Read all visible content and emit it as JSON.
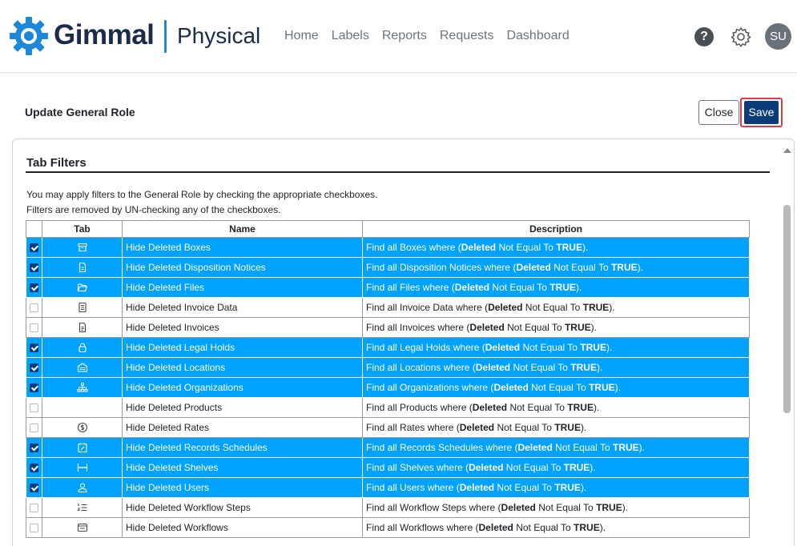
{
  "header": {
    "brand": "Gimmal",
    "product": "Physical",
    "nav": [
      "Home",
      "Labels",
      "Reports",
      "Requests",
      "Dashboard"
    ],
    "help_glyph": "?",
    "avatar_initials": "SU",
    "brand_color": "#1c2b4a",
    "accent_color": "#1e88d8"
  },
  "page": {
    "title": "Update General Role",
    "close_label": "Close",
    "save_label": "Save"
  },
  "tab_filters": {
    "section_title": "Tab Filters",
    "intro_line1": "You may apply filters to the General Role by checking the appropriate checkboxes.",
    "intro_line2": "Filters are removed by UN-checking any of the checkboxes.",
    "columns": [
      "",
      "Tab",
      "Name",
      "Description"
    ],
    "rows": [
      {
        "checked": true,
        "icon": "archive-box-icon",
        "name": "Hide Deleted Boxes",
        "entity": "Boxes"
      },
      {
        "checked": true,
        "icon": "document-icon",
        "name": "Hide Deleted Disposition Notices",
        "entity": "Disposition Notices"
      },
      {
        "checked": true,
        "icon": "folder-open-icon",
        "name": "Hide Deleted Files",
        "entity": "Files"
      },
      {
        "checked": false,
        "icon": "list-document-icon",
        "name": "Hide Deleted Invoice Data",
        "entity": "Invoice Data"
      },
      {
        "checked": false,
        "icon": "invoice-icon",
        "name": "Hide Deleted Invoices",
        "entity": "Invoices"
      },
      {
        "checked": true,
        "icon": "lock-icon",
        "name": "Hide Deleted Legal Holds",
        "entity": "Legal Holds"
      },
      {
        "checked": true,
        "icon": "warehouse-icon",
        "name": "Hide Deleted Locations",
        "entity": "Locations"
      },
      {
        "checked": true,
        "icon": "org-chart-icon",
        "name": "Hide Deleted Organizations",
        "entity": "Organizations"
      },
      {
        "checked": false,
        "icon": "",
        "name": "Hide Deleted Products",
        "entity": "Products"
      },
      {
        "checked": false,
        "icon": "dollar-coin-icon",
        "name": "Hide Deleted Rates",
        "entity": "Rates"
      },
      {
        "checked": true,
        "icon": "calendar-edit-icon",
        "name": "Hide Deleted Records Schedules",
        "entity": "Records Schedules"
      },
      {
        "checked": true,
        "icon": "shelf-icon",
        "name": "Hide Deleted Shelves",
        "entity": "Shelves"
      },
      {
        "checked": true,
        "icon": "user-icon",
        "name": "Hide Deleted Users",
        "entity": "Users"
      },
      {
        "checked": false,
        "icon": "numbered-list-icon",
        "name": "Hide Deleted Workflow Steps",
        "entity": "Workflow Steps"
      },
      {
        "checked": false,
        "icon": "workflow-card-icon",
        "name": "Hide Deleted Workflows",
        "entity": "Workflows"
      }
    ],
    "desc_prefix": "Find all ",
    "desc_where": " where (",
    "desc_field": "Deleted",
    "desc_op": " Not Equal To ",
    "desc_value": "TRUE",
    "desc_suffix": ").",
    "selected_row_color": "#00a2ff"
  }
}
